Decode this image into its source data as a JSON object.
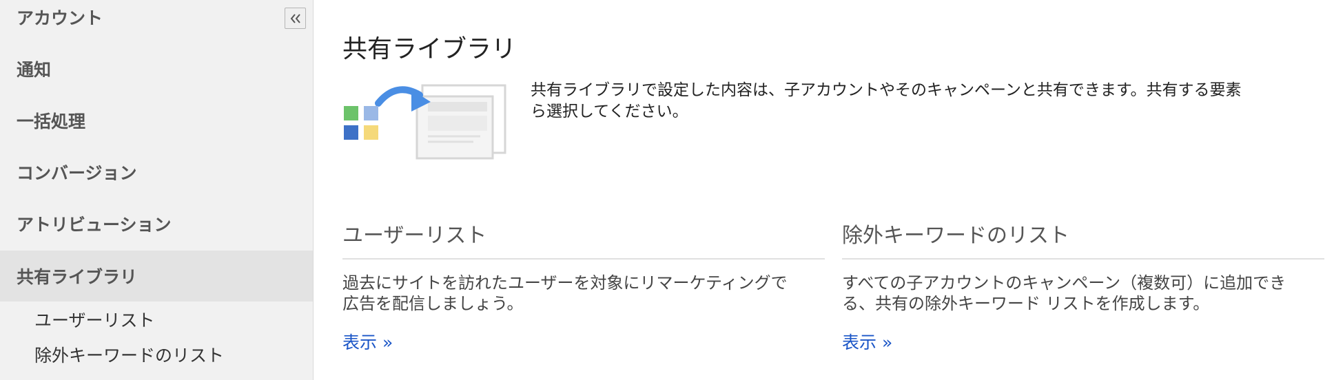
{
  "sidebar": {
    "collapse_label": "«",
    "items": [
      {
        "label": "アカウント"
      },
      {
        "label": "通知"
      },
      {
        "label": "一括処理"
      },
      {
        "label": "コンバージョン"
      },
      {
        "label": "アトリビューション"
      },
      {
        "label": "共有ライブラリ",
        "active": true
      }
    ],
    "sub_items": [
      {
        "label": "ユーザーリスト"
      },
      {
        "label": "除外キーワードのリスト"
      }
    ]
  },
  "main": {
    "title": "共有ライブラリ",
    "intro_line1": "共有ライブラリで設定した内容は、子アカウントやそのキャンペーンと共有できます。共有する要素",
    "intro_line2": "ら選択してください。",
    "cards": [
      {
        "title": "ユーザーリスト",
        "desc_line1": "過去にサイトを訪れたユーザーを対象にリマーケティングで",
        "desc_line2": "広告を配信しましょう。",
        "link": "表示 »"
      },
      {
        "title": "除外キーワードのリスト",
        "desc_line1": "すべての子アカウントのキャンペーン（複数可）に追加でき",
        "desc_line2": "る、共有の除外キーワード リストを作成します。",
        "link": "表示 »"
      }
    ]
  },
  "colors": {
    "link": "#1a55c7",
    "sidebar_bg": "#f1f1f1",
    "active_bg": "#e3e3e3",
    "arrow_blue": "#4a8ee4",
    "tile_green": "#6cc36a",
    "tile_lightblue": "#9ab8e6",
    "tile_blue": "#3d71c7",
    "tile_yellow": "#f5d97a"
  }
}
